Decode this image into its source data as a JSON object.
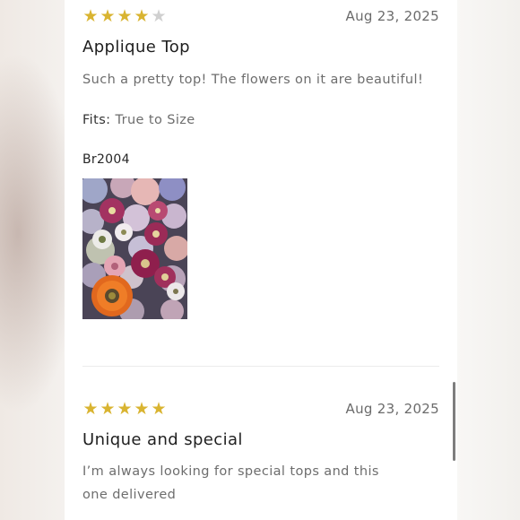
{
  "reviews": [
    {
      "rating": 4,
      "max_rating": 5,
      "date": "Aug 23, 2025",
      "title": "Applique Top",
      "body": "Such a pretty top! The flowers on it are beautiful!",
      "fits_label": "Fits:",
      "fits_value": "True to Size",
      "author": "Br2004",
      "photo_icon": "floral-appliqué-photo"
    },
    {
      "rating": 5,
      "max_rating": 5,
      "date": "Aug 23, 2025",
      "title": "Unique and special",
      "body": "I’m always looking for special tops and this one delivered"
    }
  ],
  "colors": {
    "star_filled": "#d9b431",
    "star_empty": "#d0d0d0",
    "card_background": "#ffffff"
  }
}
